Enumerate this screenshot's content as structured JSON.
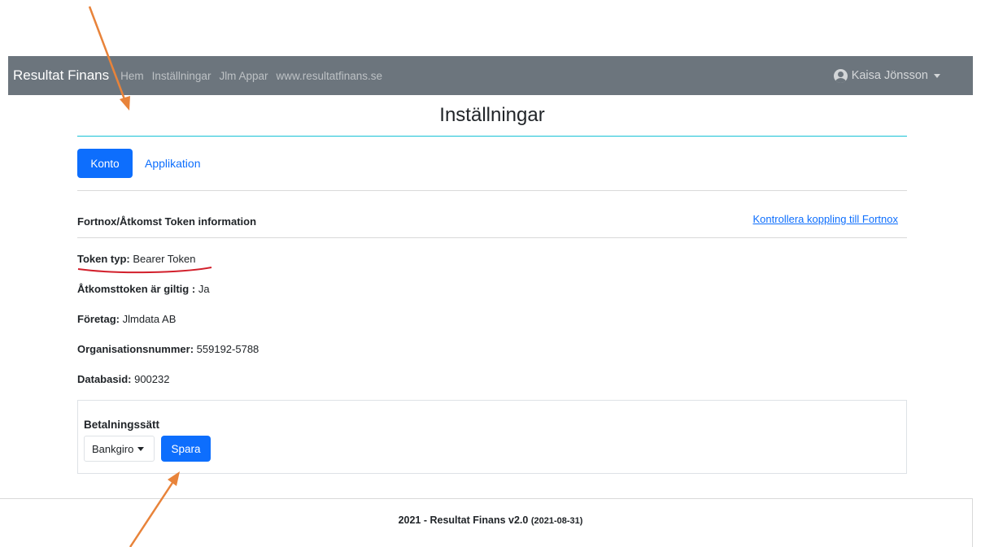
{
  "navbar": {
    "brand": "Resultat Finans",
    "links": [
      "Hem",
      "Inställningar",
      "Jlm Appar",
      "www.resultatfinans.se"
    ],
    "user": "Kaisa Jönsson"
  },
  "page": {
    "title": "Inställningar"
  },
  "tabs": {
    "active": "Konto",
    "other": "Applikation"
  },
  "token_section": {
    "title": "Fortnox/Åtkomst Token information",
    "check_link": "Kontrollera koppling till Fortnox",
    "rows": [
      {
        "label": "Token typ:",
        "value": "Bearer Token"
      },
      {
        "label": "Åtkomsttoken är giltig :",
        "value": "Ja"
      },
      {
        "label": "Företag:",
        "value": "Jlmdata AB"
      },
      {
        "label": "Organisationsnummer:",
        "value": "559192-5788"
      },
      {
        "label": "Databasid:",
        "value": "900232"
      }
    ]
  },
  "payment": {
    "label": "Betalningssätt",
    "selected": "Bankgiro",
    "save_label": "Spara"
  },
  "footer": {
    "text": "2021 - Resultat Finans v2.0",
    "date": "(2021-08-31)"
  },
  "colors": {
    "navbar": "#6c757d",
    "primary": "#0d6efd",
    "title_rule": "#17c2d6",
    "annotation_arrow": "#e8833a",
    "annotation_underline": "#d21f2b"
  }
}
